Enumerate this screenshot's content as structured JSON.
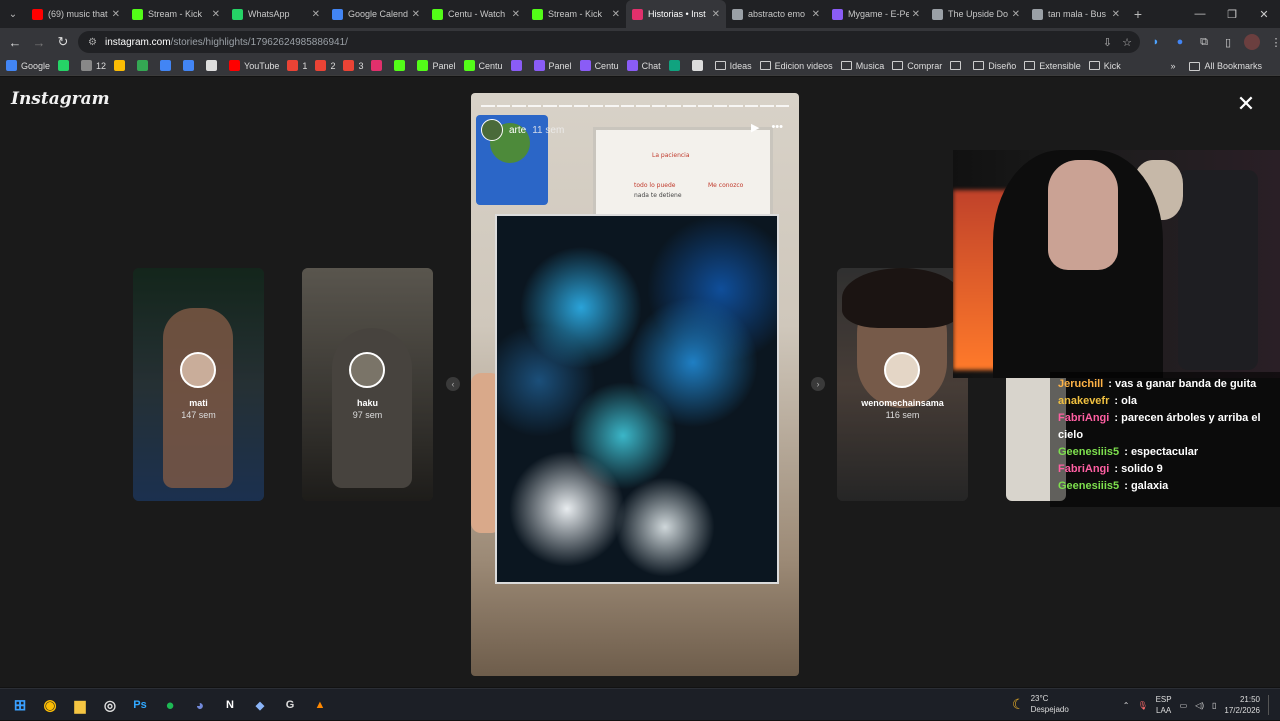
{
  "browser": {
    "tabs": [
      {
        "label": "(69) music that",
        "color": "#ff0000"
      },
      {
        "label": "Stream - Kick",
        "color": "#53fc18"
      },
      {
        "label": "WhatsApp",
        "color": "#25d366"
      },
      {
        "label": "Google Calend",
        "color": "#4285f4"
      },
      {
        "label": "Centu - Watch",
        "color": "#53fc18"
      },
      {
        "label": "Stream - Kick",
        "color": "#53fc18"
      },
      {
        "label": "Historias • Inst",
        "color": "#e1306c",
        "active": true
      },
      {
        "label": "abstracto emo",
        "color": "#9aa0a6"
      },
      {
        "label": "Mygame - E-Pe",
        "color": "#8a5cf6"
      },
      {
        "label": "The Upside Do",
        "color": "#9aa0a6"
      },
      {
        "label": "tan mala - Bus",
        "color": "#9aa0a6"
      }
    ],
    "url_host": "instagram.com",
    "url_path": "/stories/highlights/17962624985886941/",
    "bookmarks": [
      {
        "label": "Google",
        "color": "#4285f4"
      },
      {
        "label": "",
        "color": "#25d366"
      },
      {
        "label": "12",
        "color": "#888"
      },
      {
        "label": "",
        "color": "#fbbc04"
      },
      {
        "label": "",
        "color": "#34a853"
      },
      {
        "label": "",
        "color": "#4285f4"
      },
      {
        "label": "",
        "color": "#4285f4"
      },
      {
        "label": "",
        "color": "#ddd"
      },
      {
        "label": "YouTube",
        "color": "#ff0000"
      },
      {
        "label": "1",
        "color": "#ea4335"
      },
      {
        "label": "2",
        "color": "#ea4335"
      },
      {
        "label": "3",
        "color": "#ea4335"
      },
      {
        "label": "",
        "color": "#e1306c"
      },
      {
        "label": "",
        "color": "#53fc18"
      },
      {
        "label": "Panel",
        "color": "#53fc18"
      },
      {
        "label": "Centu",
        "color": "#53fc18"
      },
      {
        "label": "",
        "color": "#8a5cf6"
      },
      {
        "label": "Panel",
        "color": "#8a5cf6"
      },
      {
        "label": "Centu",
        "color": "#8a5cf6"
      },
      {
        "label": "Chat",
        "color": "#8a5cf6"
      },
      {
        "label": "",
        "color": "#10a37f"
      },
      {
        "label": "",
        "color": "#ddd"
      }
    ],
    "bookmark_folders": [
      "Ideas",
      "Edicion videos",
      "Musica",
      "Comprar",
      "",
      "Diseño",
      "Extensible",
      "Kick"
    ],
    "all_bookmarks": "All Bookmarks"
  },
  "instagram": {
    "logo": "Instagram",
    "side_stories": [
      {
        "name": "mati",
        "time": "147 sem"
      },
      {
        "name": "haku",
        "time": "97 sem"
      },
      {
        "name": "wenomechainsama",
        "time": "116 sem"
      }
    ],
    "current_story": {
      "name": "arte",
      "time": "11 sem"
    },
    "whiteboard_text": [
      "La paciencia",
      "todo lo puede",
      "nada te detiene",
      "Me conozco"
    ]
  },
  "chat": [
    {
      "user": "Jeruchill",
      "msg": "vas a ganar banda de guita",
      "color": "#ffb347"
    },
    {
      "user": "anakevefr",
      "msg": "ola",
      "color": "#f0c040"
    },
    {
      "user": "FabriAngi",
      "msg": "parecen árboles y arriba el cielo",
      "color": "#ff5fa2"
    },
    {
      "user": "Geenesiiis5",
      "msg": "espectacular",
      "color": "#7ee04e"
    },
    {
      "user": "FabriAngi",
      "msg": "solido 9",
      "color": "#ff5fa2"
    },
    {
      "user": "Geenesiiis5",
      "msg": "galaxia",
      "color": "#7ee04e"
    }
  ],
  "taskbar": {
    "weather_temp": "23°C",
    "weather_desc": "Despejado",
    "lang1": "ESP",
    "lang2": "LAA",
    "time": "21:50",
    "date": "17/2/2026"
  }
}
